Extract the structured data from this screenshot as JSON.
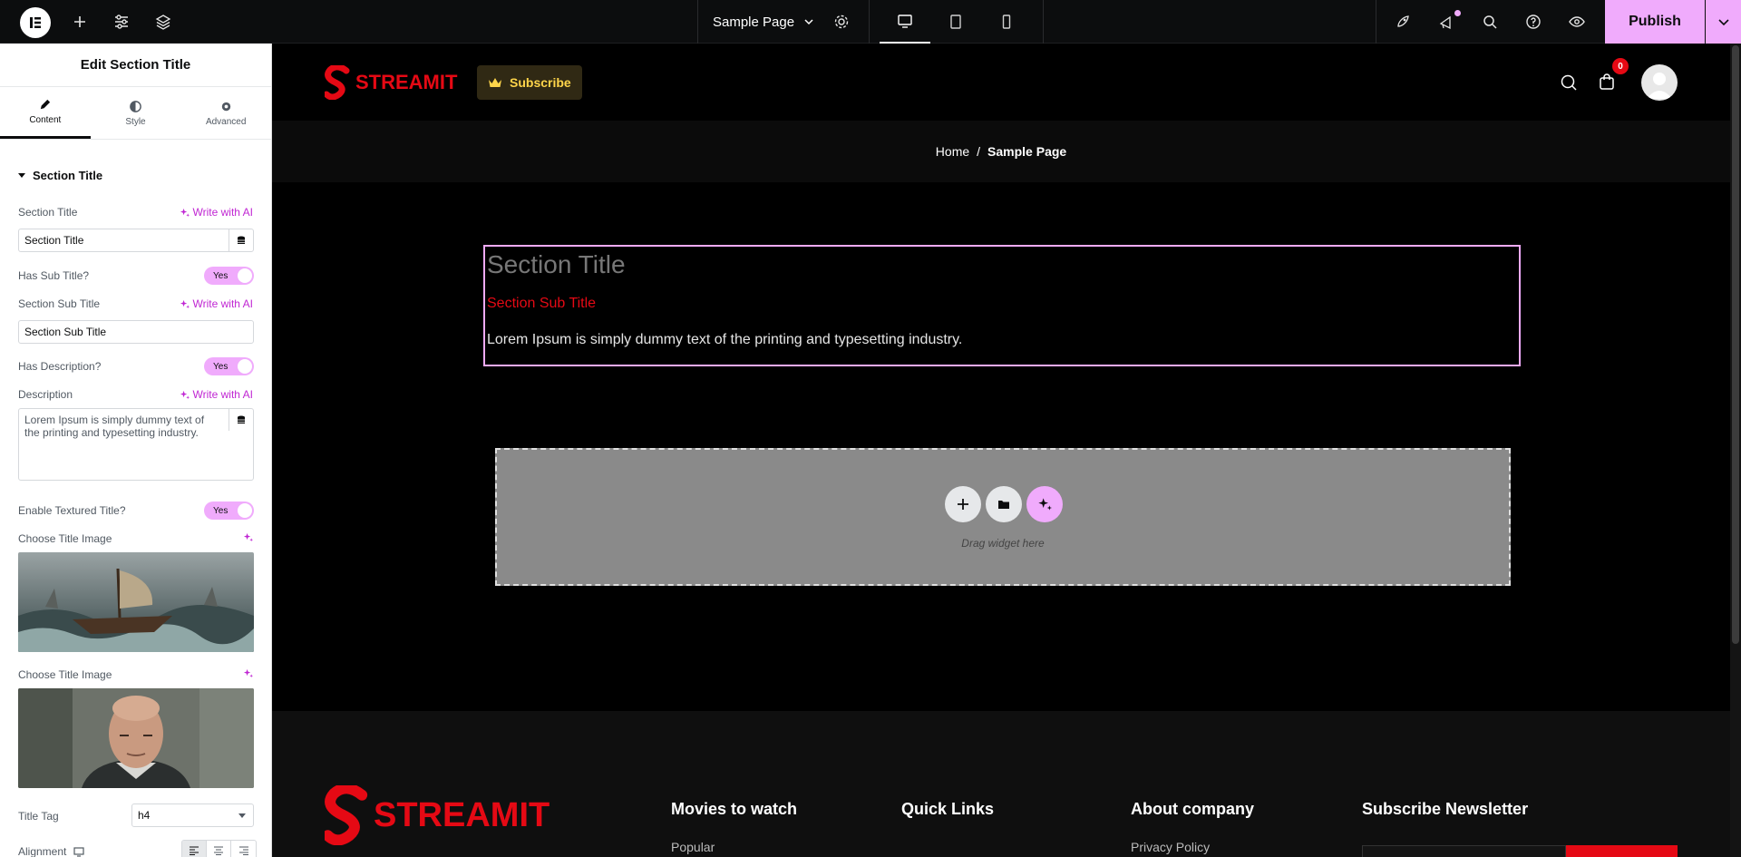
{
  "topbar": {
    "page_name": "Sample Page",
    "publish_label": "Publish",
    "colors": {
      "accent": "#f0abfc",
      "bg": "#0c0d0e"
    }
  },
  "panel": {
    "title": "Edit Section Title",
    "tabs": [
      {
        "label": "Content",
        "icon": "pencil-icon"
      },
      {
        "label": "Style",
        "icon": "contrast-icon"
      },
      {
        "label": "Advanced",
        "icon": "gear-icon"
      }
    ],
    "section_heading": "Section Title",
    "write_ai": "Write with AI",
    "fields": {
      "section_title_label": "Section Title",
      "section_title_value": "Section Title",
      "has_subtitle_label": "Has Sub Title?",
      "toggle_yes": "Yes",
      "subtitle_label": "Section Sub Title",
      "subtitle_value": "Section Sub Title",
      "has_description_label": "Has Description?",
      "description_label": "Description",
      "description_value": "Lorem Ipsum is simply dummy text of the printing and typesetting industry.",
      "textured_label": "Enable Textured Title?",
      "choose_image_label_1": "Choose Title Image",
      "choose_image_label_2": "Choose Title Image",
      "title_tag_label": "Title Tag",
      "title_tag_value": "h4",
      "alignment_label": "Alignment"
    }
  },
  "site": {
    "brand": "STREAMIT",
    "subscribe": "Subscribe",
    "cart_count": "0",
    "breadcrumb": {
      "home": "Home",
      "sep": "/",
      "current": "Sample Page"
    },
    "colors": {
      "brand": "#e50914",
      "subscribe_text": "#ffd54a"
    }
  },
  "widget": {
    "title": "Section Title",
    "subtitle": "Section Sub Title",
    "description": "Lorem Ipsum is simply dummy text of the printing and typesetting industry."
  },
  "drop_zone": {
    "hint": "Drag widget here"
  },
  "footer": {
    "columns": [
      {
        "title": "Movies to watch",
        "first_item": "Popular"
      },
      {
        "title": "Quick Links",
        "first_item": ""
      },
      {
        "title": "About company",
        "first_item": "Privacy Policy"
      },
      {
        "title": "Subscribe Newsletter",
        "first_item": ""
      }
    ]
  }
}
